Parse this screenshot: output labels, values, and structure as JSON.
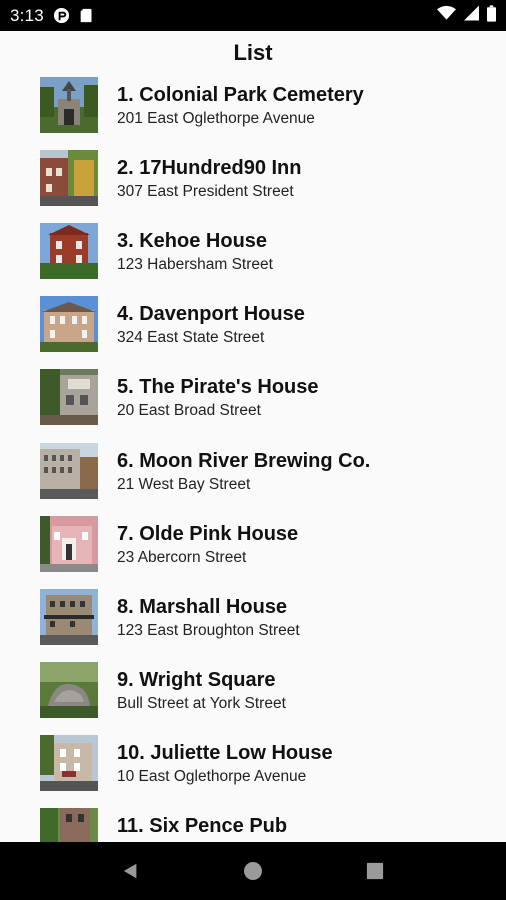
{
  "status_bar": {
    "time": "3:13",
    "icons": [
      "app-notification-icon",
      "sd-card-icon",
      "wifi-icon",
      "cell-signal-icon",
      "battery-icon"
    ]
  },
  "header": {
    "title": "List"
  },
  "list": {
    "items": [
      {
        "name": "1. Colonial Park Cemetery",
        "address": "201 East Oglethorpe Avenue"
      },
      {
        "name": "2. 17Hundred90 Inn",
        "address": "307 East President Street"
      },
      {
        "name": "3. Kehoe House",
        "address": "123 Habersham Street"
      },
      {
        "name": "4. Davenport House",
        "address": "324 East State Street"
      },
      {
        "name": "5. The Pirate's House",
        "address": "20 East Broad Street"
      },
      {
        "name": "6. Moon River Brewing Co.",
        "address": "21 West Bay Street"
      },
      {
        "name": "7. Olde Pink House",
        "address": "23 Abercorn Street"
      },
      {
        "name": "8. Marshall House",
        "address": "123 East Broughton Street"
      },
      {
        "name": "9. Wright Square",
        "address": "Bull Street at York Street"
      },
      {
        "name": "10. Juliette Low House",
        "address": "10 East Oglethorpe Avenue"
      },
      {
        "name": "11. Six Pence Pub",
        "address": ""
      }
    ]
  },
  "nav_bar": {
    "icons": [
      "back-icon",
      "home-icon",
      "recents-icon"
    ]
  },
  "colors": {
    "status_bar": "#000000",
    "nav_bar": "#000000",
    "background": "#fafafa"
  }
}
